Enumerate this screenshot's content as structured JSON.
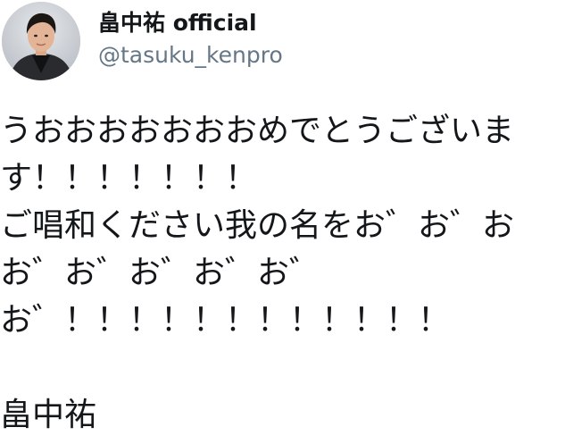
{
  "header": {
    "display_name": "畠中祐 official",
    "handle": "@tasuku_kenpro",
    "avatar_icon": "profile-photo-icon"
  },
  "tweet": {
    "lines": [
      "うおおおおおおおめでとうございま",
      "す！！！！！！！",
      "ご唱和ください我の名をお゛お゛お",
      "お゛お゛お゛お゛お゛",
      "お゛！！！！！！！！！！！！",
      "",
      "畠中祐"
    ]
  },
  "colors": {
    "text": "#14171a",
    "secondary_text": "#657786",
    "background": "#ffffff"
  }
}
